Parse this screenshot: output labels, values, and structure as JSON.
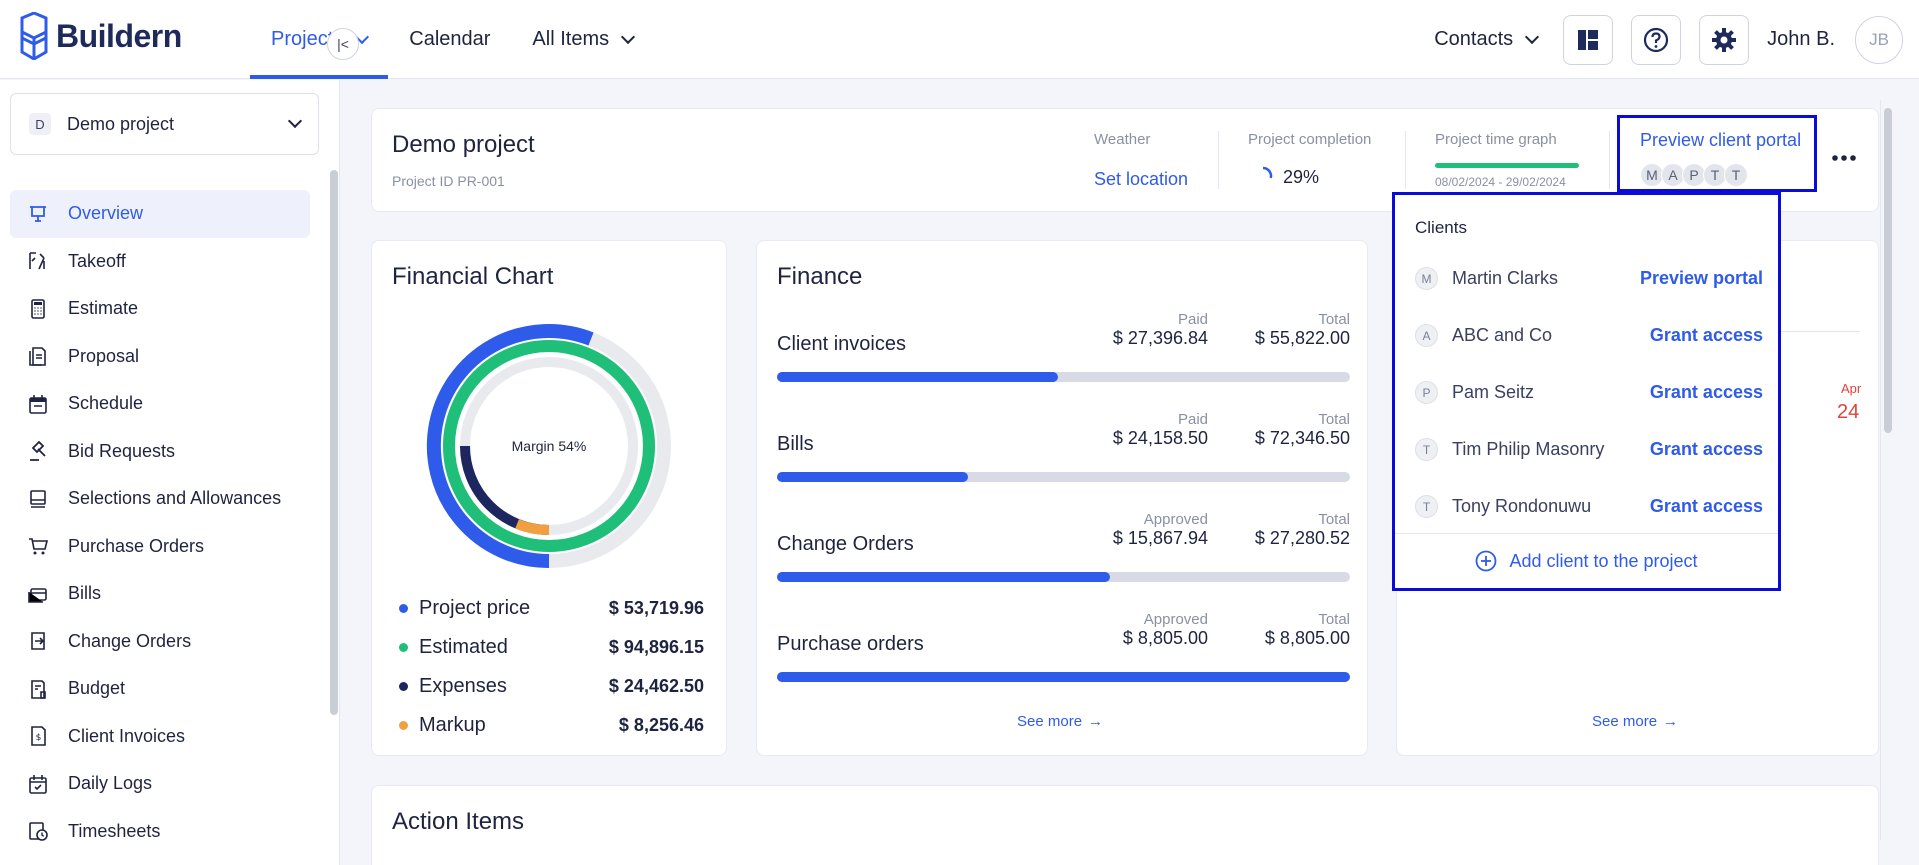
{
  "app": {
    "logo_text": "Buildern"
  },
  "nav": {
    "items": [
      {
        "label": "Projects",
        "active": true,
        "dropdown": true
      },
      {
        "label": "Calendar",
        "active": false,
        "dropdown": false
      },
      {
        "label": "All Items",
        "active": false,
        "dropdown": true
      }
    ],
    "contacts_label": "Contacts",
    "user_name": "John B.",
    "user_initials": "JB"
  },
  "sidebar": {
    "project_badge": "D",
    "project_name": "Demo project",
    "items": [
      {
        "label": "Overview",
        "icon": "presentation-icon",
        "active": true
      },
      {
        "label": "Takeoff",
        "icon": "takeoff-icon"
      },
      {
        "label": "Estimate",
        "icon": "calculator-icon"
      },
      {
        "label": "Proposal",
        "icon": "proposal-icon"
      },
      {
        "label": "Schedule",
        "icon": "calendar-icon"
      },
      {
        "label": "Bid Requests",
        "icon": "gavel-icon"
      },
      {
        "label": "Selections and Allowances",
        "icon": "selections-icon"
      },
      {
        "label": "Purchase Orders",
        "icon": "cart-icon"
      },
      {
        "label": "Bills",
        "icon": "bills-icon"
      },
      {
        "label": "Change Orders",
        "icon": "change-orders-icon"
      },
      {
        "label": "Budget",
        "icon": "budget-icon"
      },
      {
        "label": "Client Invoices",
        "icon": "invoice-icon"
      },
      {
        "label": "Daily Logs",
        "icon": "daily-log-icon"
      },
      {
        "label": "Timesheets",
        "icon": "timesheet-icon"
      }
    ]
  },
  "header": {
    "title": "Demo project",
    "project_id": "Project ID PR-001",
    "weather_label": "Weather",
    "weather_action": "Set location",
    "completion_label": "Project completion",
    "completion_value": "29%",
    "completion_fraction": 0.29,
    "time_graph_label": "Project time graph",
    "time_graph_range": "08/02/2024 - 29/02/2024",
    "portal_label": "Preview client portal",
    "portal_avatars": [
      "M",
      "A",
      "P",
      "T",
      "T"
    ]
  },
  "financial_chart": {
    "title": "Financial Chart",
    "center_label": "Margin 54%",
    "legend": [
      {
        "label": "Project price",
        "value": "$ 53,719.96",
        "color": "#2f5bea"
      },
      {
        "label": "Estimated",
        "value": "$ 94,896.15",
        "color": "#1fbf7a"
      },
      {
        "label": "Expenses",
        "value": "$ 24,462.50",
        "color": "#1e2660"
      },
      {
        "label": "Markup",
        "value": "$ 8,256.46",
        "color": "#f0a040"
      }
    ]
  },
  "finance": {
    "title": "Finance",
    "rows": [
      {
        "name": "Client invoices",
        "left_label": "Paid",
        "left_value": "$ 27,396.84",
        "right_label": "Total",
        "right_value": "$ 55,822.00",
        "fraction": 0.49
      },
      {
        "name": "Bills",
        "left_label": "Paid",
        "left_value": "$ 24,158.50",
        "right_label": "Total",
        "right_value": "$ 72,346.50",
        "fraction": 0.334
      },
      {
        "name": "Change Orders",
        "left_label": "Approved",
        "left_value": "$ 15,867.94",
        "right_label": "Total",
        "right_value": "$ 27,280.52",
        "fraction": 0.582
      },
      {
        "name": "Purchase orders",
        "left_label": "Approved",
        "left_value": "$ 8,805.00",
        "right_label": "Total",
        "right_value": "$ 8,805.00",
        "fraction": 1.0
      }
    ],
    "see_more": "See more"
  },
  "right_panel": {
    "month": "Apr",
    "day": "24",
    "see_more": "See more"
  },
  "action_items": {
    "title": "Action Items"
  },
  "clients_dropdown": {
    "title": "Clients",
    "clients": [
      {
        "initial": "M",
        "name": "Martin Clarks",
        "action": "Preview portal"
      },
      {
        "initial": "A",
        "name": "ABC and Co",
        "action": "Grant access"
      },
      {
        "initial": "P",
        "name": "Pam Seitz",
        "action": "Grant access"
      },
      {
        "initial": "T",
        "name": "Tim Philip Masonry",
        "action": "Grant access"
      },
      {
        "initial": "T",
        "name": "Tony Rondonuwu",
        "action": "Grant access"
      }
    ],
    "add_label": "Add client to the project"
  },
  "colors": {
    "accent": "#2f5bea",
    "green": "#1fbf7a",
    "navy": "#1e2660",
    "orange": "#f0a040",
    "highlight": "#0a0ad9"
  }
}
